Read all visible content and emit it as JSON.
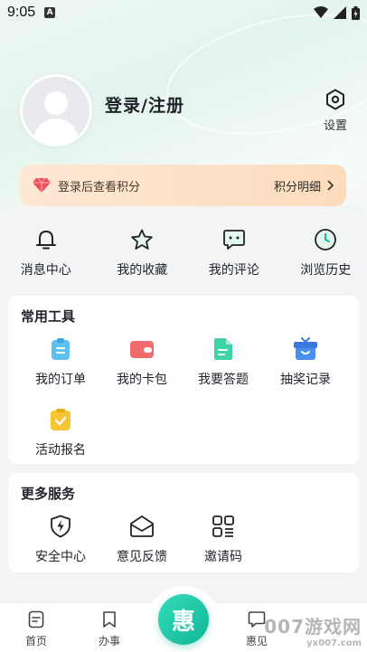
{
  "status_bar": {
    "time": "9:05",
    "sim_label": "A"
  },
  "profile": {
    "login_label": "登录/注册",
    "settings_label": "设置"
  },
  "points_banner": {
    "hint": "登录后查看积分",
    "detail_label": "积分明细"
  },
  "quick_actions": [
    {
      "label": "消息中心",
      "icon": "bell-icon"
    },
    {
      "label": "我的收藏",
      "icon": "star-icon"
    },
    {
      "label": "我的评论",
      "icon": "chat-icon"
    },
    {
      "label": "浏览历史",
      "icon": "clock-icon"
    }
  ],
  "tools": {
    "title": "常用工具",
    "items": [
      {
        "label": "我的订单",
        "icon": "order-icon",
        "color": "#5cc0f0"
      },
      {
        "label": "我的卡包",
        "icon": "wallet-icon",
        "color": "#f06c6c"
      },
      {
        "label": "我要答题",
        "icon": "document-icon",
        "color": "#3fd4a6"
      },
      {
        "label": "抽奖记录",
        "icon": "gift-box-icon",
        "color": "#4a8ef2"
      },
      {
        "label": "活动报名",
        "icon": "check-clipboard-icon",
        "color": "#f7c531"
      }
    ]
  },
  "services": {
    "title": "更多服务",
    "items": [
      {
        "label": "安全中心",
        "icon": "shield-bolt-icon"
      },
      {
        "label": "意见反馈",
        "icon": "envelope-icon"
      },
      {
        "label": "邀请码",
        "icon": "qr-grid-icon"
      }
    ]
  },
  "bottom_nav": [
    {
      "label": "首页",
      "icon": "home-doc-icon"
    },
    {
      "label": "办事",
      "icon": "bookmark-icon"
    },
    {
      "label": "惠见",
      "icon": "speech-icon"
    }
  ],
  "center_button": {
    "glyph": "惠"
  },
  "watermark": {
    "text": "007游戏网",
    "sub": "yx007.com"
  },
  "colors": {
    "accent": "#12b89a",
    "banner": "#fcdcbc"
  }
}
